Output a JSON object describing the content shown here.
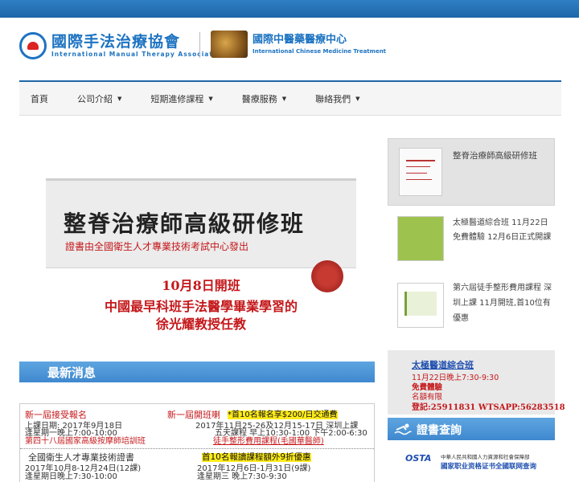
{
  "logo1": {
    "badge": "IMTA",
    "cn": "國際手法治療協會",
    "en": "International Manual Therapy Association"
  },
  "logo2": {
    "cn": "國際中醫藥醫療中心",
    "en": "International Chinese Medicine Treatment"
  },
  "nav": [
    "首頁",
    "公司介紹",
    "短期進修課程",
    "醫療服務",
    "聯絡我們"
  ],
  "banner": {
    "title": "整脊治療師高級研修班",
    "sub": "證書由全國衛生人才專業技術考試中心發出",
    "l1": "10月8日開班",
    "l2": "中國最早科班手法醫學畢業學習的",
    "l3": "徐光耀教授任教"
  },
  "news": {
    "heading": "最新消息",
    "a_title": "新一屆接受報名",
    "a_l1": "上課日期: 2017年9月18日",
    "a_l2": "逢星期一晚上7:00-10:00",
    "a_l3": "第四十八屆國家高級按摩師培訓班",
    "b_title": "新一屆開班喇",
    "b_hl": "*首10名報名享$200/日交通費",
    "b_l1": "2017年11月25-26及12月15-17日 深圳上課",
    "b_l2": "五天課程 早上10:30-1:00 下午2:00-6:30",
    "b_l3": "徒手整形費用課程(毛國華醫師)",
    "c_title": "全國衛生人才專業技術證書",
    "c_l1": "2017年10月8-12月24日(12課)",
    "c_l2": "逢星期日晚上7:30-10:00",
    "d_hl": "首10名報讀課程額外9折優惠",
    "d_l1": "2017年12月6日-1月31日(9課)",
    "d_l2": "逢星期三 晚上7:30-9:30"
  },
  "side": {
    "i1": "整脊治療師高級研修班",
    "i2a": "太極醫道綜合班 11月22日",
    "i2b": "免費體驗 12月6日正式開課",
    "i3a": "第六屆徒手整形費用課程 深",
    "i3b": "圳上課 11月開班,首10位有",
    "i3c": "優惠"
  },
  "taichi": {
    "title": "太極醫道綜合班",
    "l1": "11月22日晚上7:30-9:30",
    "l2": "免費體驗",
    "l3": "名額有限",
    "l4": "登記:25911831 WTSAPP:56283518"
  },
  "cert": {
    "heading": "證書查詢",
    "osta": "OSTA",
    "l1": "中華人民共和國人力資源和社會保障部",
    "l2": "國家职业资格证书全國联网查询"
  }
}
